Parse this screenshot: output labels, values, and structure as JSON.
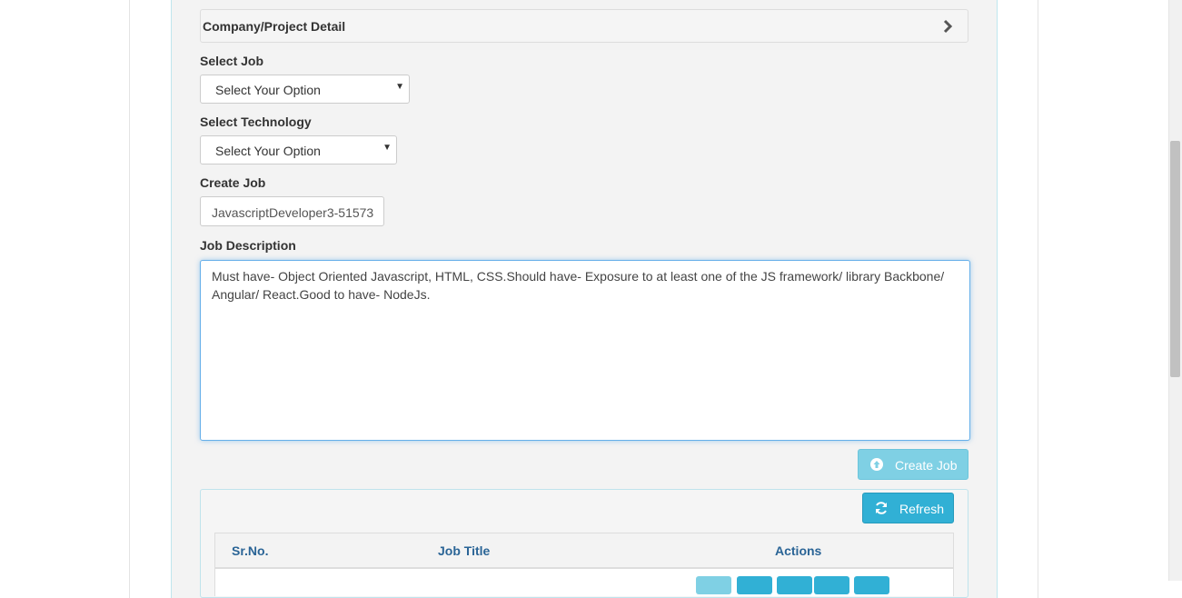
{
  "accordion": {
    "title": "Company/Project Detail"
  },
  "form": {
    "select_job": {
      "label": "Select Job",
      "value": "Select Your Option"
    },
    "select_technology": {
      "label": "Select Technology",
      "value": "Select Your Option"
    },
    "create_job": {
      "label": "Create Job",
      "value": "JavascriptDeveloper3-51573"
    },
    "job_description": {
      "label": "Job Description",
      "value": "Must have- Object Oriented Javascript, HTML, CSS.Should have- Exposure to at least one of the JS framework/ library Backbone/ Angular/ React.Good to have- NodeJs."
    },
    "create_button": "Create Job"
  },
  "list": {
    "refresh_button": "Refresh",
    "columns": [
      "Sr.No.",
      "Job Title",
      "Actions"
    ]
  },
  "colors": {
    "info": "#31b0d5",
    "info_disabled": "#7fd0e4",
    "link": "#2a6496"
  },
  "icons": {
    "accordion": "chevron-right-icon",
    "create": "upload-circle-icon",
    "refresh": "refresh-icon"
  }
}
